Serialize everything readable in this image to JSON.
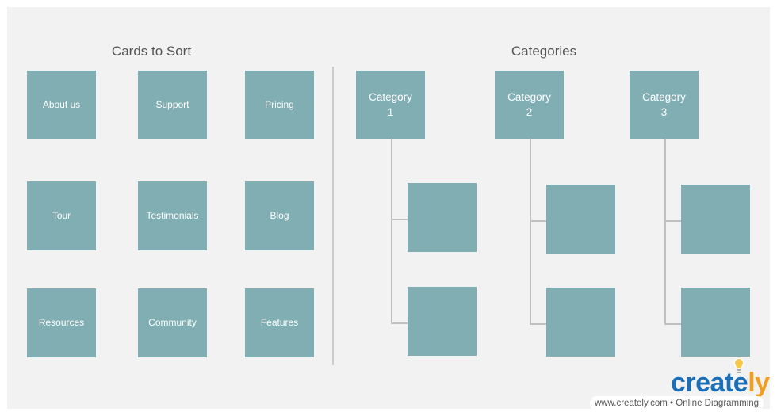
{
  "diagram": {
    "left_section": {
      "title": "Cards to Sort",
      "cards": [
        "About us",
        "Support",
        "Pricing",
        "Tour",
        "Testimonials",
        "Blog",
        "Resources",
        "Community",
        "Features"
      ]
    },
    "right_section": {
      "title": "Categories",
      "categories": [
        {
          "label": "Category\n1",
          "slots": 2
        },
        {
          "label": "Category\n2",
          "slots": 2
        },
        {
          "label": "Category\n3",
          "slots": 2
        }
      ]
    },
    "colors": {
      "card": "#80aeb2",
      "card_text": "#ffffff",
      "connector": "#c0c0c0",
      "background": "#f2f2f2"
    }
  },
  "watermark": {
    "brand_main": "create",
    "brand_accent": "ly",
    "tagline": "www.creately.com • Online Diagramming",
    "icon": "lightbulb-icon"
  }
}
